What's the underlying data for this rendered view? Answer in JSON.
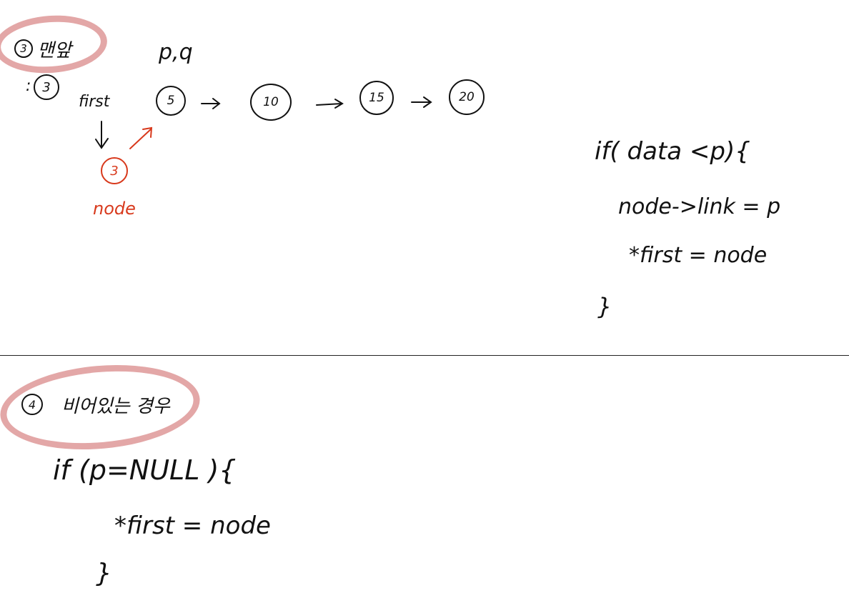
{
  "section3": {
    "number": "3",
    "title": "맨앞",
    "colon_label": ":",
    "colon_value": "3",
    "pointer_label": "p,q",
    "first_label": "first",
    "new_node_value": "3",
    "node_label": "node",
    "list": [
      "5",
      "10",
      "15",
      "20"
    ],
    "code": {
      "line1": "if( data <p){",
      "line2": "node->link = p",
      "line3": "*first = node",
      "line4": "}"
    }
  },
  "section4": {
    "number": "4",
    "title": "비어있는 경우",
    "code": {
      "line1": "if (p=NULL ){",
      "line2": "*first = node",
      "line3": "}"
    }
  },
  "colors": {
    "ink": "#111111",
    "red": "#d8391c",
    "highlight": "#e3a7a7"
  }
}
